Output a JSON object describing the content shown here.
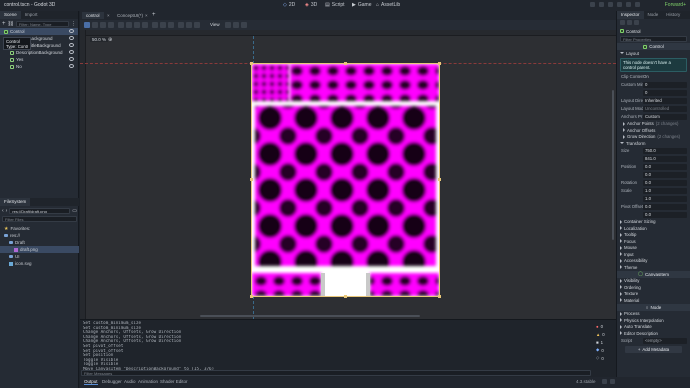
{
  "window": {
    "title": "control.tscn - Godot 3D",
    "renderer": "Forward+"
  },
  "workspaces": [
    {
      "label": "2D",
      "icon": "2d-icon"
    },
    {
      "label": "3D",
      "icon": "3d-icon"
    },
    {
      "label": "Script",
      "icon": "script-icon"
    },
    {
      "label": "Game",
      "icon": "game-icon"
    },
    {
      "label": "AssetLib",
      "icon": "assetlib-icon"
    }
  ],
  "scene_dock": {
    "tabs": [
      "Scene",
      "Import"
    ],
    "filter_placeholder": "Filter: Name, Type",
    "tooltip_lines": [
      "Control",
      "Type: Control"
    ],
    "tree": [
      {
        "label": "Control",
        "indent": 0,
        "selected": true
      },
      {
        "label": "ImageBackground",
        "indent": 1,
        "selected": false
      },
      {
        "label": "QuoteTitleBackground",
        "indent": 1,
        "selected": false
      },
      {
        "label": "DescriptionBackground",
        "indent": 1,
        "selected": false
      },
      {
        "label": "Yes",
        "indent": 1,
        "selected": false
      },
      {
        "label": "No",
        "indent": 1,
        "selected": false
      }
    ]
  },
  "filesystem_dock": {
    "tab": "FileSystem",
    "path": "res://Draft/draft.png",
    "filter_placeholder": "Filter Files",
    "items": [
      {
        "label": "Favorites:",
        "indent": 0,
        "type": "fav",
        "selected": false
      },
      {
        "label": "res://",
        "indent": 0,
        "type": "folder",
        "selected": false
      },
      {
        "label": "Draft",
        "indent": 1,
        "type": "folder",
        "selected": false
      },
      {
        "label": "draft.png",
        "indent": 2,
        "type": "image",
        "selected": true
      },
      {
        "label": "UI",
        "indent": 1,
        "type": "folder",
        "selected": false
      },
      {
        "label": "icon.svg",
        "indent": 1,
        "type": "image",
        "selected": false
      }
    ]
  },
  "scene_tabs": [
    {
      "label": "control",
      "active": true
    },
    {
      "label": "ConceptUI(*)",
      "active": false
    }
  ],
  "toolbar": {
    "view_label": "View",
    "zoom": "50.0 %"
  },
  "output": {
    "lines": [
      "Set custom_minimum_size",
      "Set custom_minimum_size",
      "Change Anchors, Offsets, Grow Direction",
      "Change Anchors, Offsets, Grow Direction",
      "Change Anchors, Offsets, Grow Direction",
      "Set pivot_offset",
      "Set pivot_offset",
      "Set position",
      "Toggle Visible",
      "Toggle Visible",
      "Move CanvasItem \"DescriptionBackground\" to (15, 376)"
    ],
    "filter_placeholder": "Filter Messages",
    "counters": [
      "0",
      "0",
      "1",
      "0",
      "0"
    ]
  },
  "bottom_tabs": [
    "Output",
    "Debugger",
    "Audio",
    "Animation",
    "Shader Editor"
  ],
  "version": "4.3.stable",
  "inspector": {
    "tabs": [
      "Inspector",
      "Node",
      "History"
    ],
    "node_label": "Control",
    "filter_placeholder": "Filter Properties",
    "class_header": "Control",
    "layout_category": "Layout",
    "warning": "This node doesn't have a control parent.",
    "clip_contents": {
      "label": "Clip Contents",
      "value": "On"
    },
    "custom_min": {
      "label": "Custom Minim",
      "x": "0",
      "y": "0"
    },
    "layout_direction": {
      "label": "Layout Directio",
      "value": "Inherited"
    },
    "layout_mode": {
      "label": "Layout Mode",
      "value": "Uncontrolled"
    },
    "anchors_preset": {
      "label": "Anchors Pr",
      "value": "Custom"
    },
    "anchor_subs": [
      {
        "label": "Anchor Points",
        "note": "(2 changes)"
      },
      {
        "label": "Anchor Offsets",
        "note": ""
      },
      {
        "label": "Grow Direction",
        "note": "(2 changes)"
      }
    ],
    "transform_label": "Transform",
    "size": {
      "label": "Size",
      "x": "750.0",
      "y": "841.0",
      "unit": "px"
    },
    "position": {
      "label": "Position",
      "x": "0.0",
      "y": "0.0",
      "unit": "px"
    },
    "rotation": {
      "label": "Rotation",
      "value": "0.0"
    },
    "scale": {
      "label": "Scale",
      "x": "1.0",
      "y": "1.0"
    },
    "pivot": {
      "label": "Pivot Offset",
      "x": "0.0",
      "y": "0.0",
      "unit": "px"
    },
    "categories_a": [
      "Container Sizing",
      "Localization",
      "Tooltip",
      "Focus",
      "Mouse",
      "Input",
      "Accessibility",
      "Theme"
    ],
    "canvasitem_header": "CanvasItem",
    "categories_b": [
      "Visibility",
      "Ordering",
      "Texture",
      "Material"
    ],
    "node_header": "Node",
    "categories_c": [
      "Process",
      "Physics Interpolation",
      "Auto Translate",
      "Editor Description"
    ],
    "script_label": "Script",
    "script_value": "<empty>",
    "add_metadata": "Add Metadata"
  },
  "colors": {
    "magenta": "#ff00ff",
    "selection": "#3a4a63",
    "accent_green": "#7fd06a",
    "warning_bg": "#1c3a3f",
    "canvas_bg": "#2d2f33"
  }
}
